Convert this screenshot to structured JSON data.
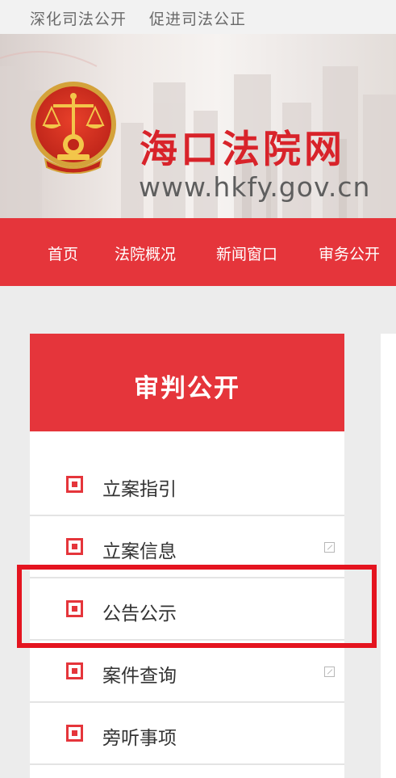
{
  "topbar": {
    "slogans": [
      "深化司法公开",
      "促进司法公正"
    ]
  },
  "header": {
    "site_name": "海口法院网",
    "site_url": "www.hkfy.gov.cn",
    "emblem_icon": "court-emblem-icon"
  },
  "nav": {
    "items": [
      {
        "label": "首页"
      },
      {
        "label": "法院概况"
      },
      {
        "label": "新闻窗口"
      },
      {
        "label": "审务公开"
      }
    ]
  },
  "sidebar": {
    "title": "审判公开",
    "items": [
      {
        "label": "立案指引",
        "icon": "bullet-square-icon",
        "external": false
      },
      {
        "label": "立案信息",
        "icon": "bullet-square-icon",
        "external": true,
        "external_icon": "external-link-icon"
      },
      {
        "label": "公告公示",
        "icon": "bullet-square-icon",
        "external": false,
        "highlighted": true
      },
      {
        "label": "案件查询",
        "icon": "bullet-square-icon",
        "external": true,
        "external_icon": "external-link-icon"
      },
      {
        "label": "旁听事项",
        "icon": "bullet-square-icon",
        "external": false
      }
    ]
  },
  "colors": {
    "brand_red": "#e5353b",
    "highlight_red": "#e4141f",
    "text_dark": "#333333",
    "text_gray": "#6a6a6a"
  }
}
